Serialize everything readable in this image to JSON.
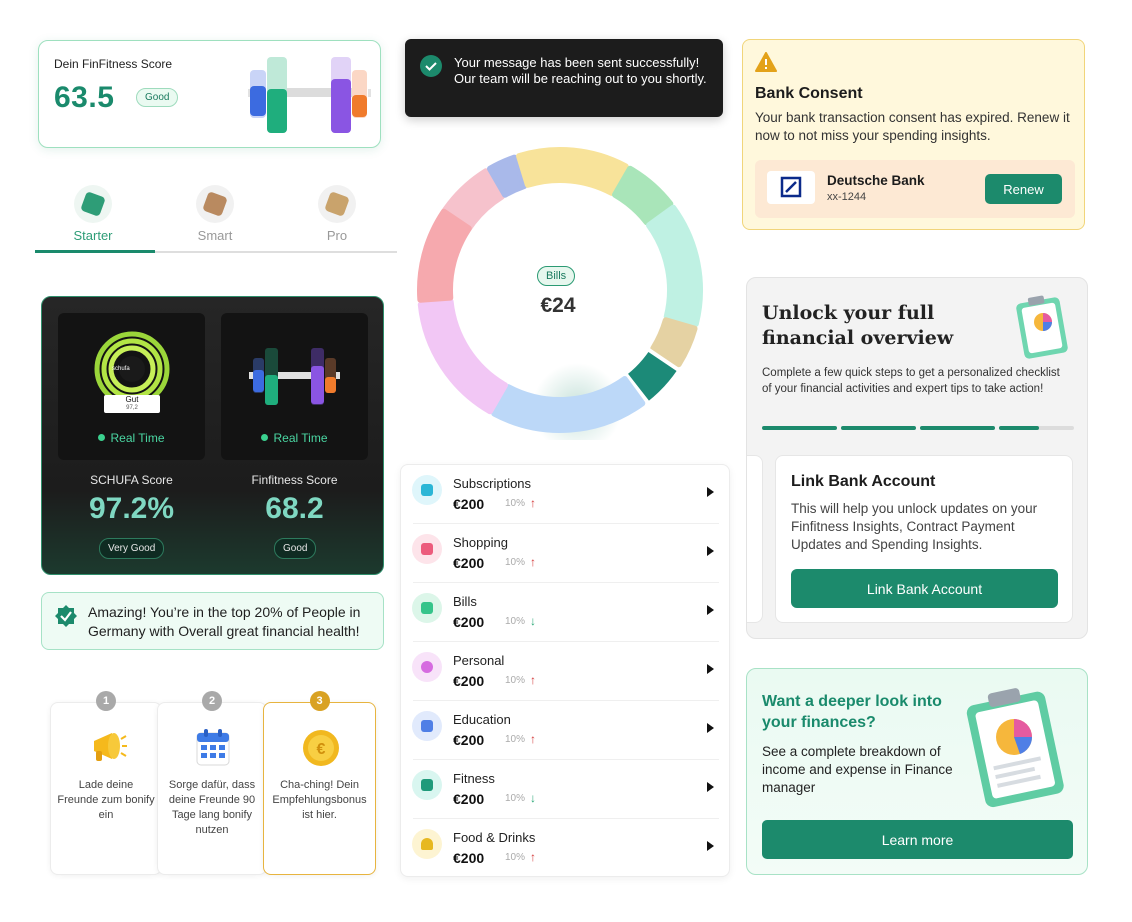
{
  "score_card": {
    "title": "Dein FinFitness Score",
    "value": "63.5",
    "badge": "Good"
  },
  "tabs": [
    {
      "label": "Starter",
      "active": true,
      "color": "#2e9d77"
    },
    {
      "label": "Smart",
      "active": false,
      "color": "#b98a60"
    },
    {
      "label": "Pro",
      "active": false,
      "color": "#c9a36c"
    }
  ],
  "dark_card": {
    "schufa": {
      "ring_label": "schufa",
      "grade": "Gut",
      "grade_value": "97,2",
      "status": "Real Time",
      "title": "SCHUFA Score",
      "value": "97.2%",
      "badge": "Very Good"
    },
    "finfitness": {
      "status": "Real Time",
      "title": "Finfitness Score",
      "value": "68.2",
      "badge": "Good"
    }
  },
  "amazing": {
    "text": "Amazing! You’re in the top 20% of People in Germany with Overall great financial health!"
  },
  "steps": [
    {
      "num": "1",
      "text": "Lade deine Freunde zum bonify ein",
      "icon": "megaphone-icon"
    },
    {
      "num": "2",
      "text": "Sorge dafür, dass deine Freunde 90 Tage lang  bonify nutzen",
      "icon": "calendar-icon"
    },
    {
      "num": "3",
      "text": "Cha-ching! Dein Empfehlungsbonus ist hier.",
      "icon": "euro-coin-icon"
    }
  ],
  "toast": {
    "text": "Your message has been sent successfully! Our team will be reaching out to you shortly."
  },
  "donut": {
    "center_label": "Bills",
    "center_value": "€24"
  },
  "categories": [
    {
      "name": "Subscriptions",
      "amount": "€200",
      "percent": "10%",
      "trend": "up",
      "icon": "calendar-icon",
      "bg": "#dff6fb",
      "fg": "#2bb6d6"
    },
    {
      "name": "Shopping",
      "amount": "€200",
      "percent": "10%",
      "trend": "up",
      "icon": "cart-icon",
      "bg": "#fde4ea",
      "fg": "#ec5b7c"
    },
    {
      "name": "Bills",
      "amount": "€200",
      "percent": "10%",
      "trend": "down",
      "icon": "receipt-icon",
      "bg": "#dcf6e9",
      "fg": "#35c48a"
    },
    {
      "name": "Personal",
      "amount": "€200",
      "percent": "10%",
      "trend": "up",
      "icon": "person-icon",
      "bg": "#f8e3f9",
      "fg": "#d66be0"
    },
    {
      "name": "Education",
      "amount": "€200",
      "percent": "10%",
      "trend": "up",
      "icon": "book-icon",
      "bg": "#e1eafc",
      "fg": "#4f7fe6"
    },
    {
      "name": "Fitness",
      "amount": "€200",
      "percent": "10%",
      "trend": "down",
      "icon": "lightning-icon",
      "bg": "#d9f6f0",
      "fg": "#1f9a7a"
    },
    {
      "name": "Food & Drinks",
      "amount": "€200",
      "percent": "10%",
      "trend": "up",
      "icon": "burger-icon",
      "bg": "#fdf4d2",
      "fg": "#e7b820"
    }
  ],
  "consent": {
    "title": "Bank Consent",
    "text": "Your bank transaction consent has expired. Renew it now to not miss your spending insights.",
    "bank_name": "Deutsche Bank",
    "bank_id": "xx-1244",
    "renew": "Renew"
  },
  "unlock": {
    "title": "Unlock your full financial overview",
    "text": "Complete a few quick steps to get a personalized checklist of your financial activities and expert tips to take action!",
    "card_title": "Link Bank Account",
    "card_text": "This will help you unlock updates on your Finfitness Insights, Contract Payment Updates and Spending Insights.",
    "button": "Link Bank Account"
  },
  "deeper": {
    "title": "Want a deeper look into your finances?",
    "text": "See a complete breakdown of income and expense in Finance manager",
    "button": "Learn more"
  },
  "colors": {
    "accent": "#1c8a6c",
    "up": "#d43a3a",
    "down": "#2aa876"
  }
}
